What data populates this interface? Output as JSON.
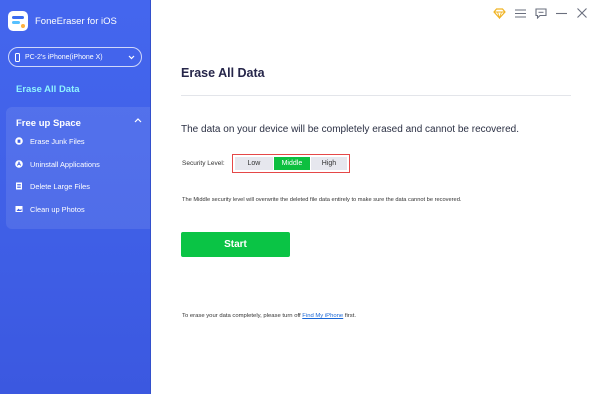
{
  "app": {
    "name": "FoneEraser for iOS"
  },
  "device": {
    "selected": "PC-2's iPhone(iPhone X)"
  },
  "sidebar": {
    "erase_all": "Erase All Data",
    "group_title": "Free up Space",
    "items": [
      {
        "label": "Erase Junk Files",
        "icon": "trash-icon"
      },
      {
        "label": "Uninstall Applications",
        "icon": "app-store-icon"
      },
      {
        "label": "Delete Large Files",
        "icon": "document-icon"
      },
      {
        "label": "Clean up Photos",
        "icon": "photo-icon"
      }
    ]
  },
  "main": {
    "title": "Erase All Data",
    "warning": "The data on your device will be completely erased and cannot be recovered.",
    "security_label": "Security Level:",
    "levels": [
      "Low",
      "Middle",
      "High"
    ],
    "selected_level": "Middle",
    "description": "The Middle security level will overwrite the deleted file data entirely to make sure the data cannot be recovered.",
    "start_label": "Start",
    "footer_prefix": "To erase your data completely, please turn off ",
    "footer_link": "Find My iPhone",
    "footer_suffix": " first."
  },
  "colors": {
    "sidebar": "#4466ee",
    "accent_text": "#8ef3ff",
    "start": "#0ac445",
    "active_level": "#0dbf3f",
    "highlight_border": "#e54848",
    "link": "#1a67d6"
  },
  "window_icons": [
    "premium-diamond-icon",
    "menu-icon",
    "feedback-icon",
    "minimize-icon",
    "close-icon"
  ]
}
